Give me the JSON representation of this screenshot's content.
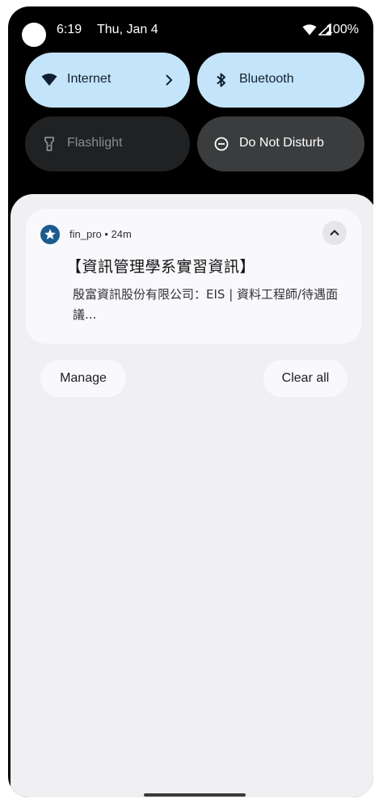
{
  "status_bar": {
    "time": "6:19",
    "date": "Thu, Jan 4",
    "battery": "100%",
    "icons": [
      "camera-dot",
      "wifi-icon",
      "signal-icon"
    ]
  },
  "quick_settings": {
    "internet": {
      "label": "Internet",
      "icon": "wifi-icon",
      "state": "on"
    },
    "bluetooth": {
      "label": "Bluetooth",
      "icon": "bluetooth-icon",
      "state": "on"
    },
    "flashlight": {
      "label": "Flashlight",
      "icon": "flashlight-icon",
      "state": "off"
    },
    "dnd": {
      "label": "Do Not Disturb",
      "icon": "do-not-disturb-icon",
      "state": "off"
    }
  },
  "notification": {
    "app_icon": "star-icon",
    "app_name": "fin_pro",
    "separator": " • ",
    "time_ago": "24m",
    "title": "【資訊管理學系實習資訊】",
    "body": "殷富資訊股份有限公司：EIS | 資料工程師/待遇面議..."
  },
  "actions": {
    "manage": "Manage",
    "clear_all": "Clear all"
  },
  "colors": {
    "tile_on": "#c4e4fa",
    "tile_off": "#1f2123",
    "shade_bg": "#f0eff1",
    "app_icon": "#1b5b8f"
  }
}
